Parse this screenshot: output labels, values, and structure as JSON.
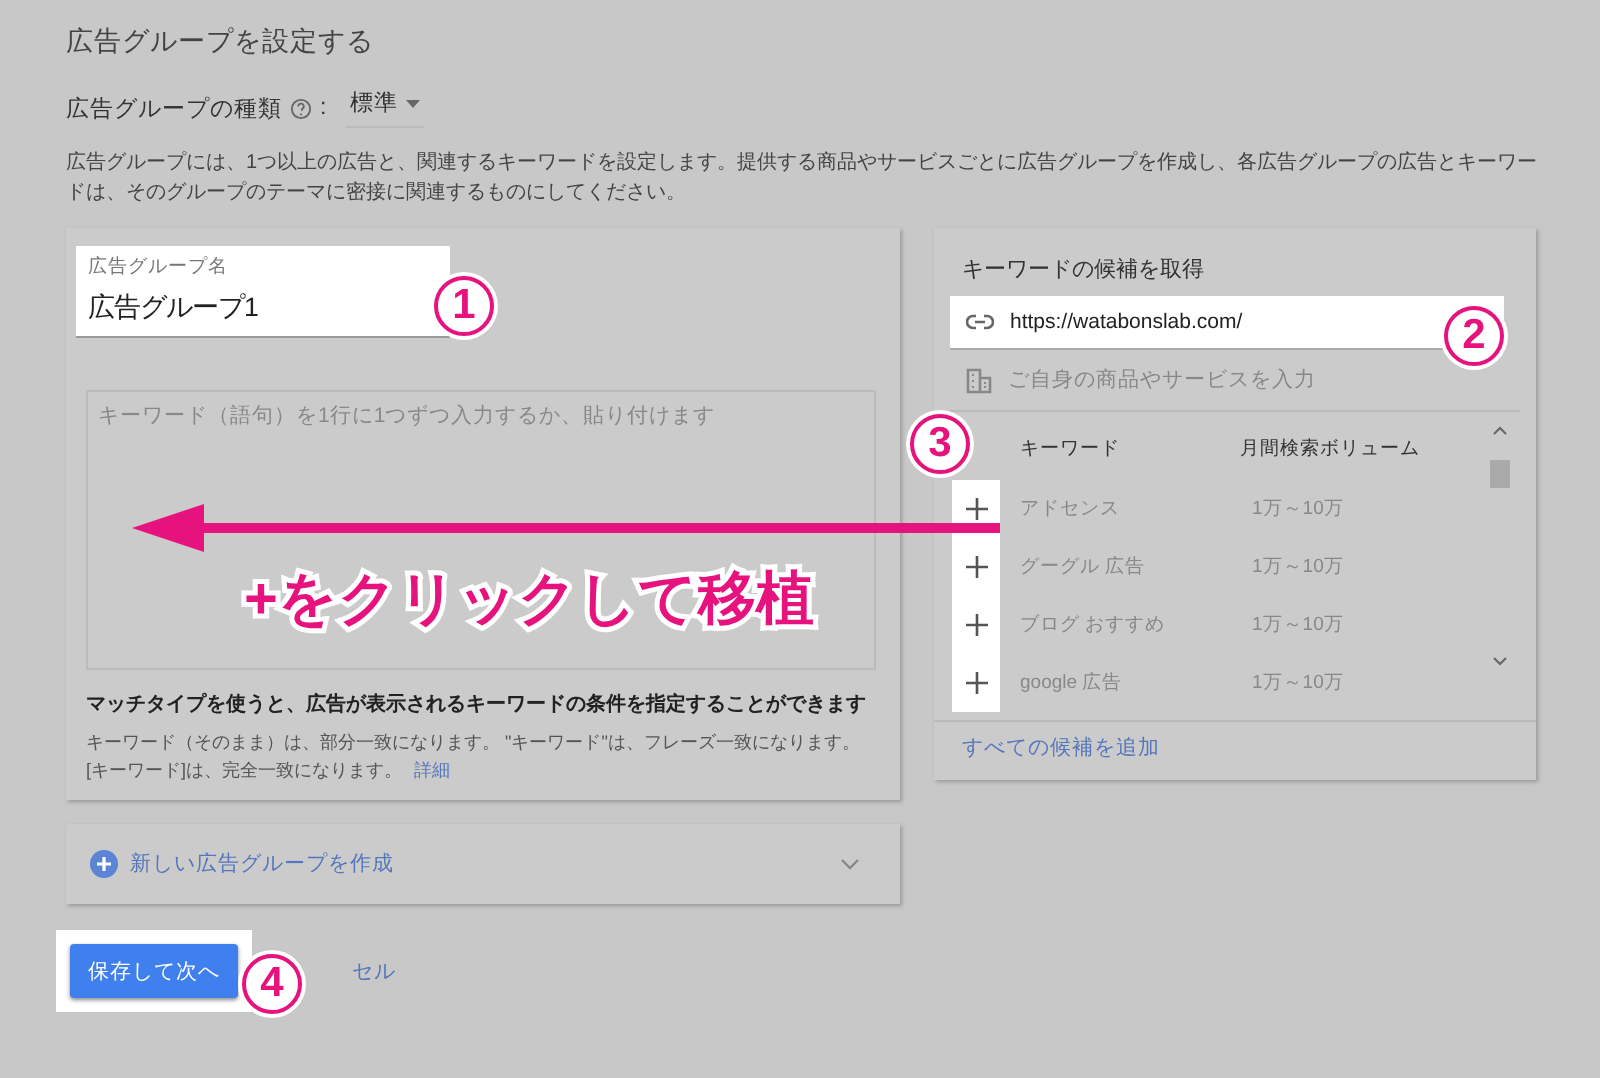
{
  "page_title": "広告グループを設定する",
  "ad_group_type": {
    "label": "広告グループの種類",
    "separator": ":",
    "value": "標準"
  },
  "description": "広告グループには、1つ以上の広告と、関連するキーワードを設定します。提供する商品やサービスごとに広告グループを作成し、各広告グループの広告とキーワードは、そのグループのテーマに密接に関連するものにしてください。",
  "ad_group_name": {
    "label": "広告グループ名",
    "value": "広告グループ1"
  },
  "keywords_field": {
    "placeholder": "キーワード（語句）を1行に1つずつ入力するか、貼り付けます"
  },
  "match_type": {
    "heading": "マッチタイプを使うと、広告が表示されるキーワードの条件を指定することができます",
    "note": "キーワード（そのまま）は、部分一致になります。 \"キーワード\"は、フレーズ一致になります。[キーワード]は、完全一致になります。",
    "link": "詳細"
  },
  "suggestions": {
    "title": "キーワードの候補を取得",
    "url": "https://watabonslab.com/",
    "product_placeholder": "ご自身の商品やサービスを入力",
    "columns": [
      "キーワード",
      "月間検索ボリューム"
    ],
    "rows": [
      {
        "keyword": "アドセンス",
        "volume": "1万～10万"
      },
      {
        "keyword": "グーグル 広告",
        "volume": "1万～10万"
      },
      {
        "keyword": "ブログ おすすめ",
        "volume": "1万～10万"
      },
      {
        "keyword": "google 広告",
        "volume": "1万～10万"
      }
    ],
    "add_all": "すべての候補を追加"
  },
  "new_group": {
    "label": "新しい広告グループを作成"
  },
  "save_button": "保存して次へ",
  "cancel_link": "セル",
  "annotations": {
    "markers": [
      "1",
      "2",
      "3",
      "4"
    ],
    "arrow_label": "+をクリックして移植"
  }
}
